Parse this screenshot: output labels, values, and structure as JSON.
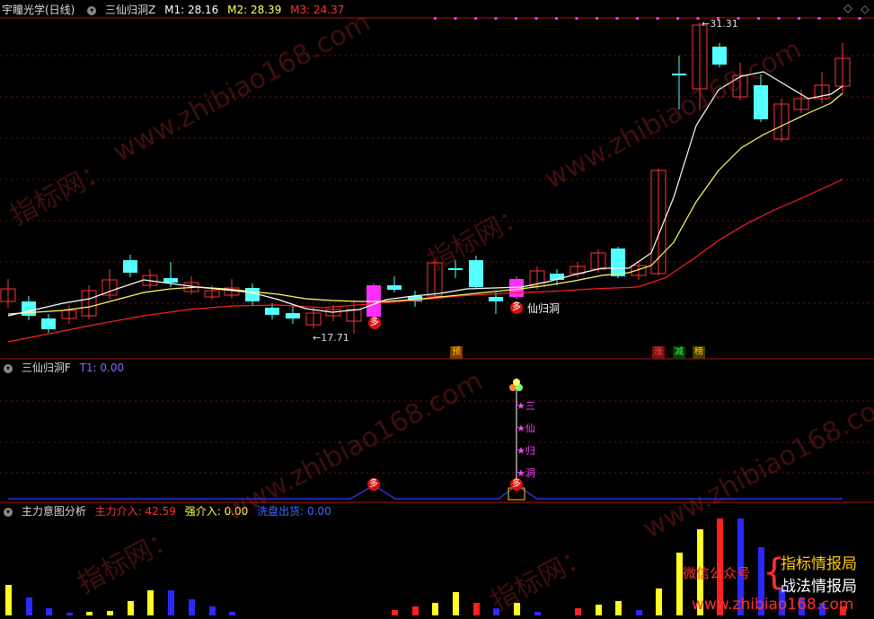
{
  "main_panel": {
    "title": "宇瞳光学(日线)",
    "indicator": "三仙归洞Z",
    "m1_label": "M1: 28.16",
    "m2_label": "M2: 28.39",
    "m3_label": "M3: 24.37",
    "high_label": "31.31",
    "low_label": "17.71",
    "signal_label": "仙归洞",
    "tags": [
      "预",
      "涨",
      "减",
      "榜"
    ],
    "duo": "多"
  },
  "panel2": {
    "title": "三仙归洞F",
    "t1_label": "T1: 0.00",
    "marks": [
      "三",
      "仙",
      "归",
      "洞"
    ],
    "duo": "多"
  },
  "panel3": {
    "title": "主力意图分析",
    "v1_label": "主力介入: 42.59",
    "v2_label": "强介入: 0.00",
    "v3_label": "洗盘出货: 0.00"
  },
  "promo": {
    "brace_label": "微信公众号",
    "line1": "指标情报局",
    "line2": "战法情报局",
    "url": "www.zhibiao168.com"
  },
  "watermarks": {
    "brand": "指标网：",
    "site": "www.zhibiao168.com"
  },
  "colors": {
    "up": "#ff3333",
    "down": "#54ffff",
    "magenta": "#ff2eff",
    "m1": "#ffffff",
    "m2": "#ffff66",
    "m3": "#ff2020",
    "blue_line": "#3a3aff"
  },
  "icons": {
    "settings": "gear-icon",
    "collapse": "chevron-down-icon"
  }
}
